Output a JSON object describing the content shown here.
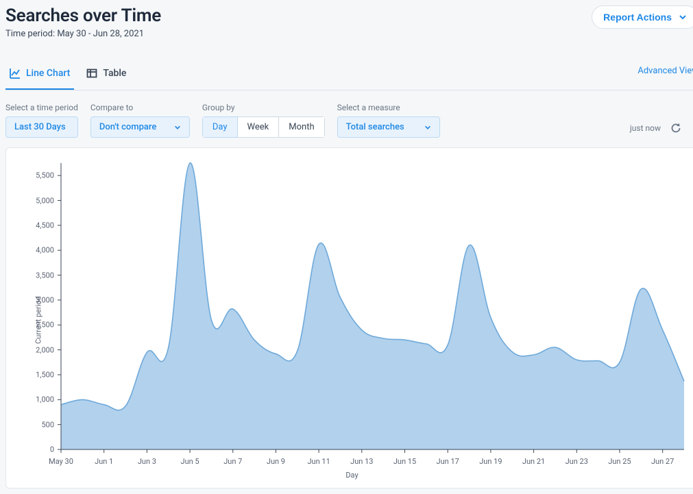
{
  "header": {
    "title": "Searches over Time",
    "subtitle": "Time period: May 30 - Jun 28, 2021",
    "report_actions_label": "Report Actions"
  },
  "tabs": {
    "line_chart": "Line Chart",
    "table": "Table",
    "advanced_view": "Advanced View"
  },
  "controls": {
    "time_period_label": "Select a time period",
    "time_period_value": "Last 30 Days",
    "compare_label": "Compare to",
    "compare_value": "Don't compare",
    "group_by_label": "Group by",
    "group_day": "Day",
    "group_week": "Week",
    "group_month": "Month",
    "measure_label": "Select a measure",
    "measure_value": "Total searches",
    "status_text": "just now"
  },
  "chart_data": {
    "type": "area",
    "title": "",
    "xlabel": "Day",
    "ylabel": "Current period",
    "y_ticks": [
      0,
      500,
      1000,
      1500,
      2000,
      2500,
      3000,
      3500,
      4000,
      4500,
      5000,
      5500
    ],
    "ylim": [
      0,
      5750
    ],
    "x_tick_labels": [
      "May 30",
      "Jun 1",
      "Jun 3",
      "Jun 5",
      "Jun 7",
      "Jun 9",
      "Jun 11",
      "Jun 13",
      "Jun 15",
      "Jun 17",
      "Jun 19",
      "Jun 21",
      "Jun 23",
      "Jun 25",
      "Jun 27"
    ],
    "x_tick_indices": [
      0,
      2,
      4,
      6,
      8,
      10,
      12,
      14,
      16,
      18,
      20,
      22,
      24,
      26,
      28
    ],
    "x": [
      "May 30",
      "May 31",
      "Jun 1",
      "Jun 2",
      "Jun 3",
      "Jun 4",
      "Jun 5",
      "Jun 6",
      "Jun 7",
      "Jun 8",
      "Jun 9",
      "Jun 10",
      "Jun 11",
      "Jun 12",
      "Jun 13",
      "Jun 14",
      "Jun 15",
      "Jun 16",
      "Jun 17",
      "Jun 18",
      "Jun 19",
      "Jun 20",
      "Jun 21",
      "Jun 22",
      "Jun 23",
      "Jun 24",
      "Jun 25",
      "Jun 26",
      "Jun 27",
      "Jun 28"
    ],
    "values": [
      900,
      1000,
      900,
      870,
      1950,
      2050,
      5750,
      2600,
      2820,
      2200,
      1920,
      1980,
      4120,
      3050,
      2400,
      2230,
      2200,
      2120,
      2100,
      4100,
      2650,
      1960,
      1900,
      2050,
      1800,
      1780,
      1750,
      3220,
      2400,
      1370
    ]
  }
}
